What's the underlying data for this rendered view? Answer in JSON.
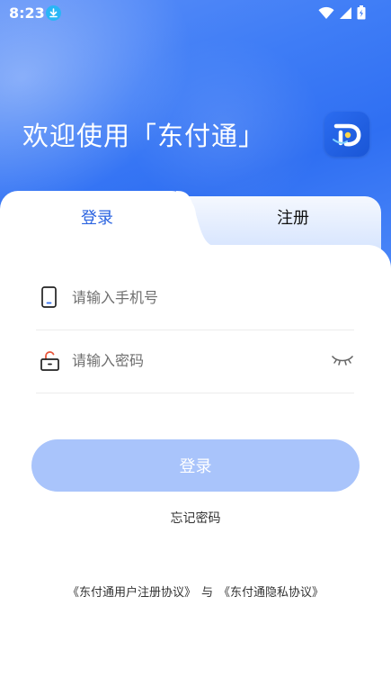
{
  "status_bar": {
    "time": "8:23"
  },
  "header": {
    "welcome_text": "欢迎使用「东付通」"
  },
  "tabs": {
    "login": "登录",
    "register": "注册"
  },
  "form": {
    "phone": {
      "placeholder": "请输入手机号",
      "value": ""
    },
    "password": {
      "placeholder": "请输入密码",
      "value": ""
    }
  },
  "buttons": {
    "login": "登录",
    "forgot_password": "忘记密码"
  },
  "agreements": {
    "user_agreement": "《东付通用户注册协议》",
    "conjunction": "与",
    "privacy_agreement": "《东付通隐私协议》"
  },
  "colors": {
    "primary": "#2f6ff2",
    "tab_active_text": "#2a63e0",
    "button_disabled": "#a9c4fb"
  },
  "icons": {
    "download": "download-icon",
    "wifi": "wifi-icon",
    "signal": "signal-icon",
    "battery": "battery-icon",
    "phone": "phone-icon",
    "lock": "lock-icon",
    "eye": "eye-closed-icon"
  }
}
